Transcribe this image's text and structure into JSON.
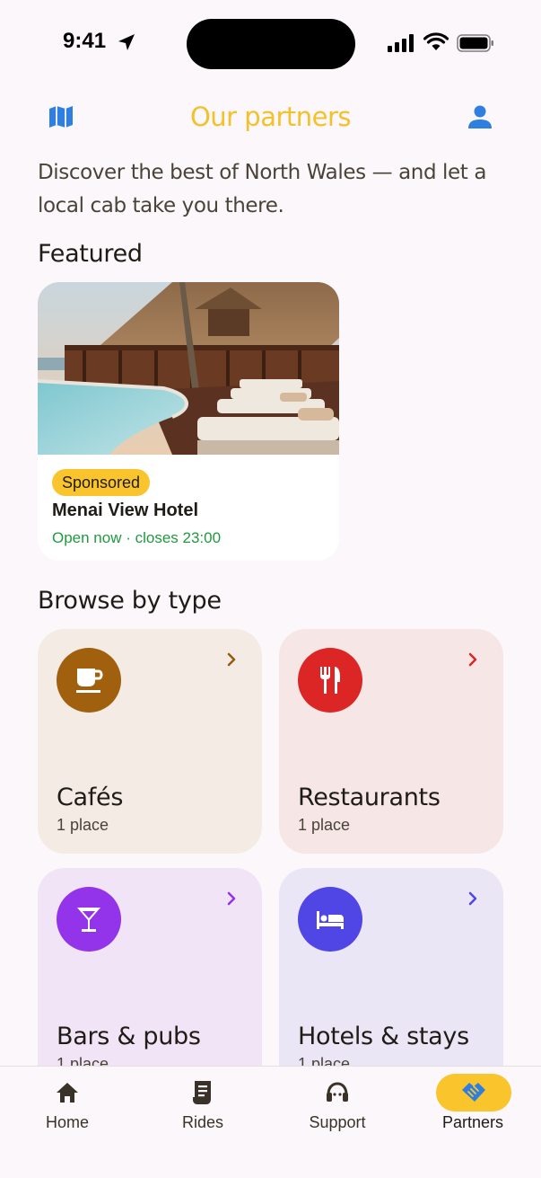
{
  "status_bar": {
    "time": "9:41"
  },
  "header": {
    "title": "Our partners",
    "map_icon": "map-icon",
    "profile_icon": "person-icon"
  },
  "intro": "Discover the best of North Wales — and let a local cab take you there.",
  "featured": {
    "section_title": "Featured",
    "card": {
      "badge": "Sponsored",
      "name": "Menai View Hotel",
      "status": "Open now · closes 23:00"
    }
  },
  "browse": {
    "section_title": "Browse by type",
    "categories": [
      {
        "name": "Cafés",
        "count": "1 place",
        "icon": "coffee-cup-icon",
        "color": "#a0600e",
        "bg": "#f4ebe4",
        "chevron_color": "#9a5a10"
      },
      {
        "name": "Restaurants",
        "count": "1 place",
        "icon": "cutlery-icon",
        "color": "#dc2626",
        "bg": "#f6e6e6",
        "chevron_color": "#dc2626"
      },
      {
        "name": "Bars & pubs",
        "count": "1 place",
        "icon": "cocktail-icon",
        "color": "#9333ea",
        "bg": "#f0e4f6",
        "chevron_color": "#9333ea"
      },
      {
        "name": "Hotels & stays",
        "count": "1 place",
        "icon": "bed-icon",
        "color": "#4f46e5",
        "bg": "#ebe6f6",
        "chevron_color": "#4f46e5"
      }
    ]
  },
  "bottom_nav": {
    "items": [
      {
        "label": "Home",
        "icon": "home-icon"
      },
      {
        "label": "Rides",
        "icon": "receipt-icon"
      },
      {
        "label": "Support",
        "icon": "headset-icon"
      },
      {
        "label": "Partners",
        "icon": "handshake-icon",
        "active": true
      }
    ]
  },
  "colors": {
    "accent": "#f9c42c",
    "title": "#f3c12b",
    "blue": "#2f7fe0",
    "open_green": "#1f9a3f"
  }
}
